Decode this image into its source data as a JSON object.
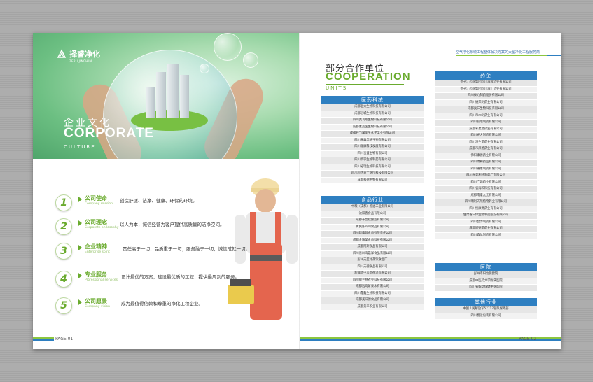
{
  "left": {
    "logo": {
      "name": "择睿净化",
      "sub": "ZERUIJINGHUA"
    },
    "culture": {
      "cn": "企业文化",
      "en": "CORPORATE",
      "sub": "CULTURE"
    },
    "items": [
      {
        "num": "1",
        "title": "公司使命",
        "en": "Company mission",
        "desc": "创造舒适、洁净、健康、环保的环境。"
      },
      {
        "num": "2",
        "title": "公司理念",
        "en": "Corporate philosophy",
        "desc": "以人为本，诚信经营为客户提供高质量的洁净空间。"
      },
      {
        "num": "3",
        "title": "企业精神",
        "en": "Enterprise spirit",
        "desc": "责任高于一切，品质重于一切；服务融于一切，诚信成就一切。"
      },
      {
        "num": "4",
        "title": "专业服务",
        "en": "Professional services",
        "desc": "设计最优的方案，建设最优质的工程，提供最周到的服务。"
      },
      {
        "num": "5",
        "title": "公司愿景",
        "en": "Company vision",
        "desc": "成为最值得信赖和尊重的净化工程企业。"
      }
    ],
    "page": "PAGE 01"
  },
  "right": {
    "tagline": "空气净化系统工程整体解决方案的大型净化工程服务商",
    "coop": {
      "cn": "部分合作单位",
      "en": "COOPERATION",
      "sub": "UNITS"
    },
    "sections": [
      {
        "title": "医药科技",
        "items": [
          "成都医大生物科技有限公司",
          "成都冠城生物科技有限公司",
          "四川奥飞翔生物科技有限公司",
          "成都素克医生物科技有限公司",
          "成都开飞翼能生化学工业有限公司",
          "四川赛森华研生物有限公司",
          "四川瑞康科技发展有限公司",
          "四川百盛生物有限公司",
          "四川新宇生物制药有限公司",
          "四川拓瑞生物科技有限公司",
          "四川超伊迪士医疗科技有限公司",
          "成都科德生物有限公司"
        ]
      },
      {
        "title": "食品行业",
        "items": [
          "中粮（成都）粮油工业有限公司",
          "沈阳香食品有限公司",
          "成都十盈软酿造有限公司",
          "青爽陈四川食品有限公司",
          "四川新康源食品有限责任公司",
          "成都金旗美食品科技有限公司",
          "成都阿斯食品有限公司",
          "四川省川海晨洋食品有限公司",
          "彭州天蓝绿茶饮食品厂",
          "四川天德食品有限公司",
          "新疆北屯市新德泽有限公司",
          "四川银兰特农业科技有限公司",
          "成都远岛矿泉水有限公司",
          "四川鑫鑫生物科技有限公司",
          "成都美味德食品有限公司",
          "成都黄丰农业有限公司"
        ]
      },
      {
        "title": "药企",
        "items": [
          "扬子江药业集团四川海蓉药业有限公司",
          "扬子江药业集团四川海汇药业有限公司",
          "四川泰力制药股份有限公司",
          "四川通荣制药业有限公司",
          "成都奥仁生物科技有限公司",
          "四川禾木制药业有限公司",
          "四川航瑞制药有限公司",
          "成都彩星达药业有限公司",
          "四川光大制药有限公司",
          "四川济生堂药业有限公司",
          "成都市凤德药业有限公司",
          "佛阳康德药业有限公司",
          "四川博和药业有限公司",
          "四川通康制药有限公司",
          "四川省美利特制药厂有限公司",
          "四川广源药业有限公司",
          "四川省海和科技有限公司",
          "成都南康九元有限公司",
          "四川明利天然植物药业有限公司",
          "四川恒康源药业有限公司",
          "甘肃省一体生物制药股份有限公司",
          "四川合力制药有限公司",
          "成都同德堂药业有限公司",
          "四川森弘制药有限公司"
        ]
      },
      {
        "title": "医院",
        "items": [
          "彭州市妇幼保健院",
          "成都中医药大学附属医院",
          "四川省妇幼保健中医医院"
        ]
      },
      {
        "title": "其他行业",
        "items": [
          "中国人民解放军57717部队保障部",
          "四川蜀运包装有限公司"
        ]
      }
    ],
    "page": "PAGE 02"
  }
}
